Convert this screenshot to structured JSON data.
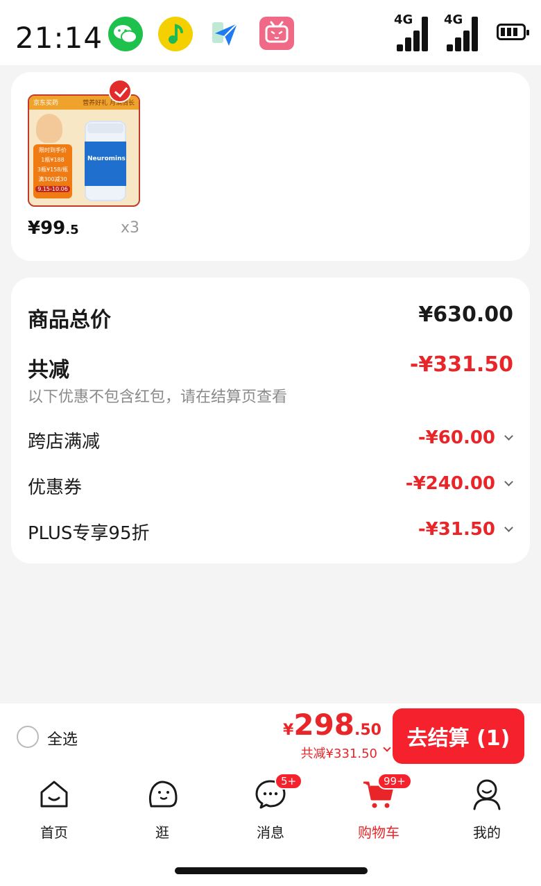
{
  "status_bar": {
    "time": "21:14",
    "signal1": "4G",
    "signal2": "4G",
    "apps": [
      "wechat-icon",
      "qq-music-icon",
      "paper-plane-icon",
      "bilibili-icon"
    ]
  },
  "product": {
    "thumb_brand": "京东买药",
    "thumb_slogan": "营养好礼 月满情长",
    "thumb_line1": "限时到手价",
    "thumb_line2": "1瓶¥188",
    "thumb_line3": "3瓶¥158/瓶",
    "thumb_line4": "满300减30",
    "thumb_date": "9.15-10.06",
    "bottle_label": "Neuromins",
    "price_int": "¥99",
    "price_dec": ".5",
    "quantity": "x3"
  },
  "summary": {
    "total_label": "商品总价",
    "total_value": "¥630.00",
    "discount_label": "共减",
    "discount_value": "-¥331.50",
    "note": "以下优惠不包含红包，请在结算页查看",
    "items": [
      {
        "label": "跨店满减",
        "value": "-¥60.00"
      },
      {
        "label": "优惠券",
        "value": "-¥240.00"
      },
      {
        "label": "PLUS专享95折",
        "value": "-¥31.50"
      }
    ]
  },
  "checkout": {
    "select_all": "全选",
    "currency": "¥",
    "price_int": "298",
    "price_dec": ".50",
    "saved": "共减¥331.50",
    "button": "去结算 (1)"
  },
  "tabs": [
    {
      "label": "首页",
      "icon": "home-icon"
    },
    {
      "label": "逛",
      "icon": "browse-icon"
    },
    {
      "label": "消息",
      "icon": "message-icon",
      "badge": "5+"
    },
    {
      "label": "购物车",
      "icon": "cart-icon",
      "badge": "99+",
      "active": true
    },
    {
      "label": "我的",
      "icon": "profile-icon"
    }
  ],
  "colors": {
    "accent": "#e8262a",
    "button": "#f5222d",
    "background": "#f4f4f4"
  }
}
